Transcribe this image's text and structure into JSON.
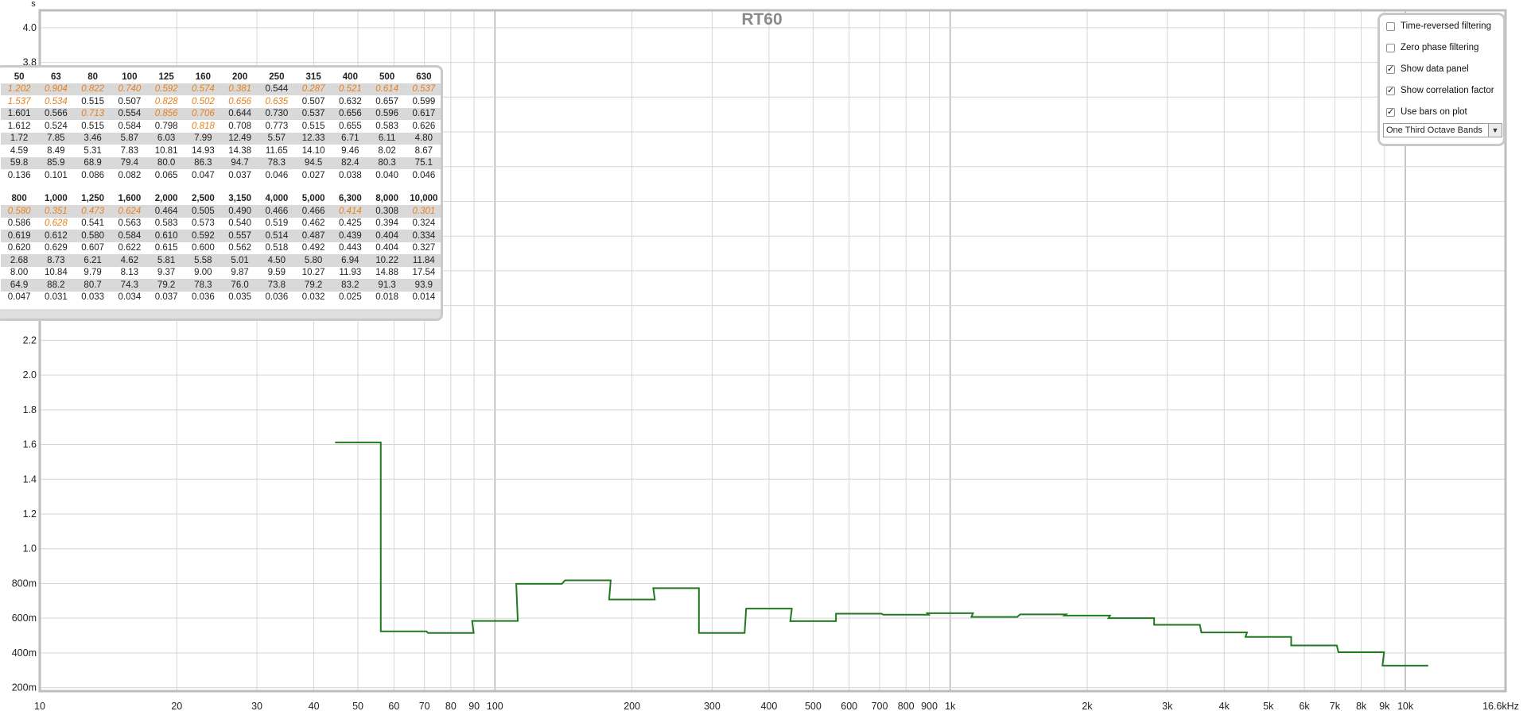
{
  "chart_data": {
    "type": "line",
    "title": "RT60",
    "ylabel": "s",
    "xlabel": "",
    "x_scale": "log",
    "xlim": [
      10,
      16600
    ],
    "ylim": [
      0.18,
      4.1
    ],
    "grid": true,
    "x_tick_labels": [
      {
        "v": 10,
        "t": "10"
      },
      {
        "v": 20,
        "t": "20"
      },
      {
        "v": 30,
        "t": "30"
      },
      {
        "v": 40,
        "t": "40"
      },
      {
        "v": 50,
        "t": "50"
      },
      {
        "v": 60,
        "t": "60"
      },
      {
        "v": 70,
        "t": "70"
      },
      {
        "v": 80,
        "t": "80"
      },
      {
        "v": 90,
        "t": "90"
      },
      {
        "v": 100,
        "t": "100"
      },
      {
        "v": 200,
        "t": "200"
      },
      {
        "v": 300,
        "t": "300"
      },
      {
        "v": 400,
        "t": "400"
      },
      {
        "v": 500,
        "t": "500"
      },
      {
        "v": 600,
        "t": "600"
      },
      {
        "v": 700,
        "t": "700"
      },
      {
        "v": 800,
        "t": "800"
      },
      {
        "v": 900,
        "t": "900"
      },
      {
        "v": 1000,
        "t": "1k"
      },
      {
        "v": 2000,
        "t": "2k"
      },
      {
        "v": 3000,
        "t": "3k"
      },
      {
        "v": 4000,
        "t": "4k"
      },
      {
        "v": 5000,
        "t": "5k"
      },
      {
        "v": 6000,
        "t": "6k"
      },
      {
        "v": 7000,
        "t": "7k"
      },
      {
        "v": 8000,
        "t": "8k"
      },
      {
        "v": 9000,
        "t": "9k"
      },
      {
        "v": 10000,
        "t": "10k"
      },
      {
        "v": 16600,
        "t": "16.6kHz"
      }
    ],
    "y_tick_labels": [
      {
        "v": 0.2,
        "t": "200m"
      },
      {
        "v": 0.4,
        "t": "400m"
      },
      {
        "v": 0.6,
        "t": "600m"
      },
      {
        "v": 0.8,
        "t": "800m"
      },
      {
        "v": 1.0,
        "t": "1.0"
      },
      {
        "v": 1.2,
        "t": "1.2"
      },
      {
        "v": 1.4,
        "t": "1.4"
      },
      {
        "v": 1.6,
        "t": "1.6"
      },
      {
        "v": 1.8,
        "t": "1.8"
      },
      {
        "v": 2.0,
        "t": "2.0"
      },
      {
        "v": 2.2,
        "t": "2.2"
      },
      {
        "v": 3.8,
        "t": "3.8"
      },
      {
        "v": 4.0,
        "t": "4.0"
      }
    ],
    "series": [
      {
        "color": "#1f7a1f",
        "bands": [
          50,
          63,
          80,
          100,
          125,
          160,
          200,
          250,
          315,
          400,
          500,
          630,
          800,
          1000,
          1250,
          1600,
          2000,
          2500,
          3150,
          4000,
          5000,
          6300,
          8000,
          10000
        ],
        "values": [
          1.612,
          0.524,
          0.515,
          0.584,
          0.798,
          0.818,
          0.708,
          0.773,
          0.515,
          0.655,
          0.583,
          0.626,
          0.62,
          0.629,
          0.607,
          0.622,
          0.615,
          0.6,
          0.562,
          0.518,
          0.492,
          0.443,
          0.404,
          0.327
        ]
      }
    ]
  },
  "data_panel": {
    "table1": {
      "headers": [
        "50",
        "63",
        "80",
        "100",
        "125",
        "160",
        "200",
        "250",
        "315",
        "400",
        "500",
        "630"
      ],
      "rows": [
        {
          "shaded": true,
          "cells": [
            "1.202",
            "0.904",
            "0.822",
            "0.740",
            "0.592",
            "0.574",
            "0.381",
            "0.544",
            "0.287",
            "0.521",
            "0.614",
            "0.537"
          ],
          "warn": [
            0,
            1,
            2,
            3,
            4,
            5,
            6,
            8,
            9,
            10,
            11
          ]
        },
        {
          "shaded": false,
          "cells": [
            "1.537",
            "0.534",
            "0.515",
            "0.507",
            "0.828",
            "0.502",
            "0.656",
            "0.635",
            "0.507",
            "0.632",
            "0.657",
            "0.599"
          ],
          "warn": [
            0,
            1,
            4,
            5,
            6,
            7
          ]
        },
        {
          "shaded": true,
          "cells": [
            "1.601",
            "0.566",
            "0.713",
            "0.554",
            "0.856",
            "0.706",
            "0.644",
            "0.730",
            "0.537",
            "0.656",
            "0.596",
            "0.617"
          ],
          "warn": [
            2,
            4,
            5
          ]
        },
        {
          "shaded": false,
          "cells": [
            "1.612",
            "0.524",
            "0.515",
            "0.584",
            "0.798",
            "0.818",
            "0.708",
            "0.773",
            "0.515",
            "0.655",
            "0.583",
            "0.626"
          ],
          "warn": [
            5
          ]
        },
        {
          "shaded": true,
          "cells": [
            "1.72",
            "7.85",
            "3.46",
            "5.87",
            "6.03",
            "7.99",
            "12.49",
            "5.57",
            "12.33",
            "6.71",
            "6.11",
            "4.80"
          ],
          "warn": []
        },
        {
          "shaded": false,
          "cells": [
            "4.59",
            "8.49",
            "5.31",
            "7.83",
            "10.81",
            "14.93",
            "14.38",
            "11.65",
            "14.10",
            "9.46",
            "8.02",
            "8.67"
          ],
          "warn": []
        },
        {
          "shaded": true,
          "cells": [
            "59.8",
            "85.9",
            "68.9",
            "79.4",
            "80.0",
            "86.3",
            "94.7",
            "78.3",
            "94.5",
            "82.4",
            "80.3",
            "75.1"
          ],
          "warn": []
        },
        {
          "shaded": false,
          "cells": [
            "0.136",
            "0.101",
            "0.086",
            "0.082",
            "0.065",
            "0.047",
            "0.037",
            "0.046",
            "0.027",
            "0.038",
            "0.040",
            "0.046"
          ],
          "warn": []
        }
      ]
    },
    "table2": {
      "headers": [
        "800",
        "1,000",
        "1,250",
        "1,600",
        "2,000",
        "2,500",
        "3,150",
        "4,000",
        "5,000",
        "6,300",
        "8,000",
        "10,000"
      ],
      "rows": [
        {
          "shaded": true,
          "cells": [
            "0.580",
            "0.351",
            "0.473",
            "0.624",
            "0.464",
            "0.505",
            "0.490",
            "0.466",
            "0.466",
            "0.414",
            "0.308",
            "0.301"
          ],
          "warn": [
            0,
            1,
            2,
            3,
            9,
            11
          ]
        },
        {
          "shaded": false,
          "cells": [
            "0.586",
            "0.628",
            "0.541",
            "0.563",
            "0.583",
            "0.573",
            "0.540",
            "0.519",
            "0.462",
            "0.425",
            "0.394",
            "0.324"
          ],
          "warn": [
            1
          ]
        },
        {
          "shaded": true,
          "cells": [
            "0.619",
            "0.612",
            "0.580",
            "0.584",
            "0.610",
            "0.592",
            "0.557",
            "0.514",
            "0.487",
            "0.439",
            "0.404",
            "0.334"
          ],
          "warn": []
        },
        {
          "shaded": false,
          "cells": [
            "0.620",
            "0.629",
            "0.607",
            "0.622",
            "0.615",
            "0.600",
            "0.562",
            "0.518",
            "0.492",
            "0.443",
            "0.404",
            "0.327"
          ],
          "warn": []
        },
        {
          "shaded": true,
          "cells": [
            "2.68",
            "8.73",
            "6.21",
            "4.62",
            "5.81",
            "5.58",
            "5.01",
            "4.50",
            "5.80",
            "6.94",
            "10.22",
            "11.84"
          ],
          "warn": []
        },
        {
          "shaded": false,
          "cells": [
            "8.00",
            "10.84",
            "9.79",
            "8.13",
            "9.37",
            "9.00",
            "9.87",
            "9.59",
            "10.27",
            "11.93",
            "14.88",
            "17.54"
          ],
          "warn": []
        },
        {
          "shaded": true,
          "cells": [
            "64.9",
            "88.2",
            "80.7",
            "74.3",
            "79.2",
            "78.3",
            "76.0",
            "73.8",
            "79.2",
            "83.2",
            "91.3",
            "93.9"
          ],
          "warn": []
        },
        {
          "shaded": false,
          "cells": [
            "0.047",
            "0.031",
            "0.033",
            "0.034",
            "0.037",
            "0.036",
            "0.035",
            "0.036",
            "0.032",
            "0.025",
            "0.018",
            "0.014"
          ],
          "warn": []
        }
      ]
    },
    "warn_color": "#e8801e"
  },
  "options": {
    "time_reversed": {
      "label": "Time-reversed filtering",
      "checked": false
    },
    "zero_phase": {
      "label": "Zero phase filtering",
      "checked": false
    },
    "show_data_panel": {
      "label": "Show data panel",
      "checked": true
    },
    "show_correlation": {
      "label": "Show correlation factor",
      "checked": true
    },
    "use_bars": {
      "label": "Use bars on plot",
      "checked": true
    },
    "band_select": {
      "value": "One Third Octave Bands"
    }
  }
}
